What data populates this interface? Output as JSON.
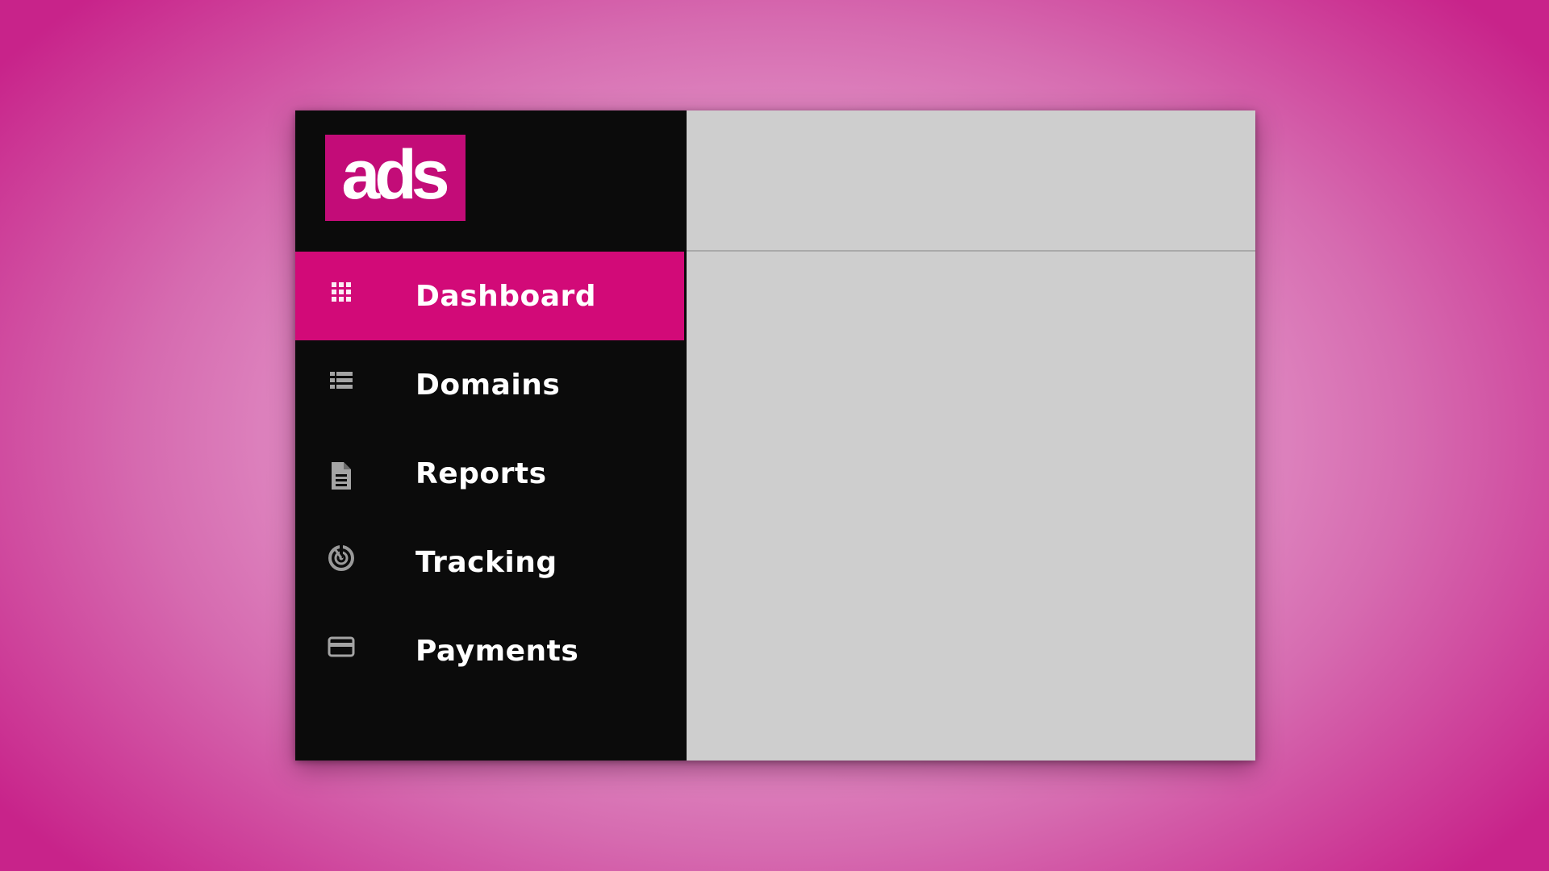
{
  "app": {
    "logo_text": "ads",
    "brand_color": "#c30c78",
    "active_color": "#d20a78"
  },
  "sidebar": {
    "items": [
      {
        "label": "Dashboard",
        "icon": "grid-icon",
        "active": true
      },
      {
        "label": "Domains",
        "icon": "list-icon",
        "active": false
      },
      {
        "label": "Reports",
        "icon": "file-icon",
        "active": false
      },
      {
        "label": "Tracking",
        "icon": "radar-icon",
        "active": false
      },
      {
        "label": "Payments",
        "icon": "credit-card-icon",
        "active": false
      }
    ]
  }
}
